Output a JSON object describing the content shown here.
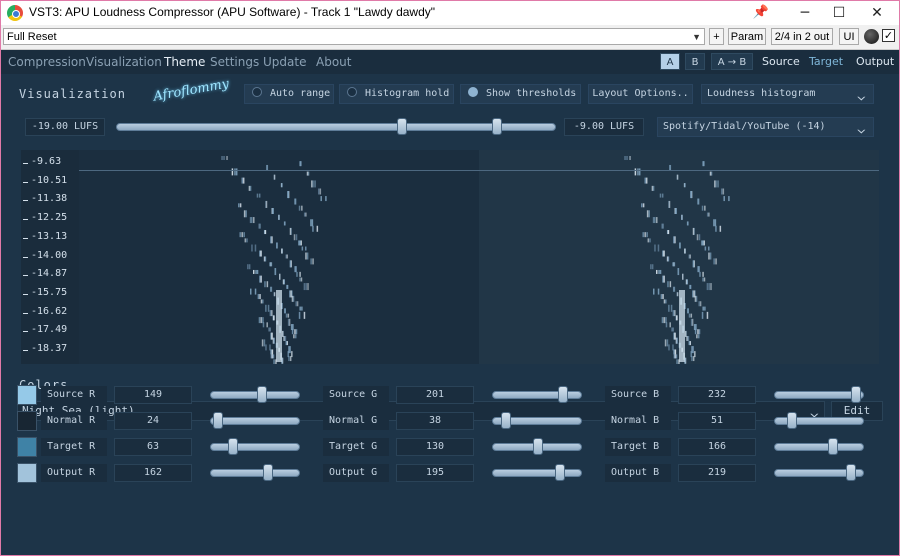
{
  "window": {
    "title": "VST3: APU Loudness Compressor (APU Software) - Track 1 \"Lawdy dawdy\"",
    "pin_icon": "pin-icon",
    "minimize": "─",
    "maximize": "☐",
    "close": "✕"
  },
  "toolbar": {
    "preset": "Full Reset",
    "plus": "+",
    "param": "Param",
    "io": "2/4 in 2 out",
    "ui": "UI",
    "enabled_check": "✓"
  },
  "tabs": [
    "Compression",
    "Visualization",
    "Theme",
    "Settings",
    "Update",
    "About"
  ],
  "active_tab": "Theme",
  "ab": {
    "a": "A",
    "b": "B",
    "copy": "A → B"
  },
  "views": {
    "source": "Source",
    "target": "Target",
    "output": "Output"
  },
  "visualization": {
    "title": "Visualization",
    "logo": "Afroflommy",
    "auto_range": "Auto range",
    "histogram_hold": "Histogram hold",
    "show_thresholds": "Show thresholds",
    "layout_options": "Layout Options..",
    "mode": "Loudness histogram",
    "min_value": "-19.00 LUFS",
    "max_value": "-9.00 LUFS",
    "range_low": 0.65,
    "range_high": 0.865,
    "target_preset": "Spotify/Tidal/YouTube (-14)",
    "y_labels": [
      "-9.63",
      "-10.51",
      "-11.38",
      "-12.25",
      "-13.13",
      "-14.00",
      "-14.87",
      "-15.75",
      "-16.62",
      "-17.49",
      "-18.37"
    ]
  },
  "colors": {
    "title": "Colors",
    "preset": "Night Sea (light)",
    "edit": "Edit",
    "rows": [
      {
        "name": "Source",
        "swatch": "#95c9e8",
        "r": {
          "label": "Source R",
          "value": "149",
          "pos": 0.58
        },
        "g": {
          "label": "Source G",
          "value": "201",
          "pos": 0.79
        },
        "b": {
          "label": "Source B",
          "value": "232",
          "pos": 0.91
        }
      },
      {
        "name": "Normal",
        "swatch": "#182633",
        "r": {
          "label": "Normal R",
          "value": "24",
          "pos": 0.09
        },
        "g": {
          "label": "Normal G",
          "value": "38",
          "pos": 0.15
        },
        "b": {
          "label": "Normal B",
          "value": "51",
          "pos": 0.2
        }
      },
      {
        "name": "Target",
        "swatch": "#3f82a6",
        "r": {
          "label": "Target R",
          "value": "63",
          "pos": 0.25
        },
        "g": {
          "label": "Target G",
          "value": "130",
          "pos": 0.51
        },
        "b": {
          "label": "Target B",
          "value": "166",
          "pos": 0.65
        }
      },
      {
        "name": "Output",
        "swatch": "#a2c3db",
        "r": {
          "label": "Output R",
          "value": "162",
          "pos": 0.64
        },
        "g": {
          "label": "Output G",
          "value": "195",
          "pos": 0.76
        },
        "b": {
          "label": "Output B",
          "value": "219",
          "pos": 0.86
        }
      }
    ]
  },
  "theme_colors": {
    "background": "#1d3448",
    "accent": "#b4d0e8"
  }
}
